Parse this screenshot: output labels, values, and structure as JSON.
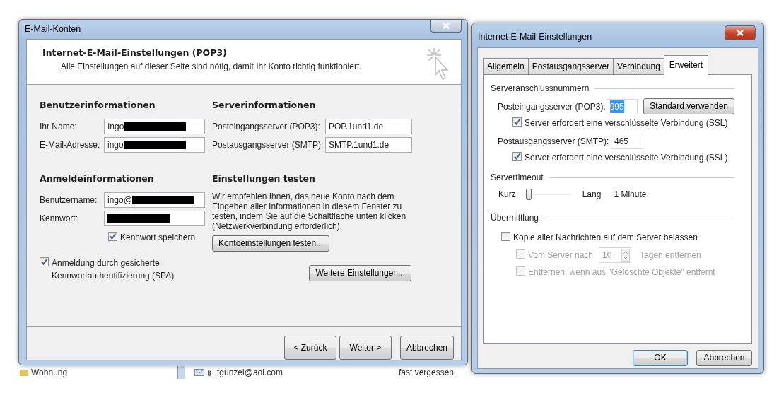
{
  "background_window": {
    "folder": "Wohnung",
    "mail": {
      "sender": "tgunzel@aol.com",
      "subject": "fast vergessen"
    }
  },
  "mail_accounts_dialog": {
    "title": "E-Mail-Konten",
    "header": {
      "title": "Internet-E-Mail-Einstellungen (POP3)",
      "subtitle": "Alle Einstellungen auf dieser Seite sind nötig, damit Ihr Konto richtig funktioniert."
    },
    "user_info": {
      "heading": "Benutzerinformationen",
      "fields": [
        {
          "label": "Ihr Name:",
          "value": "Ingo",
          "redacted": true
        },
        {
          "label": "E-Mail-Adresse:",
          "value": "ingo",
          "redacted": true
        }
      ]
    },
    "logon_info": {
      "heading": "Anmeldeinformationen",
      "fields": [
        {
          "label": "Benutzername:",
          "value": "ingo@",
          "redacted": true
        },
        {
          "label": "Kennwort:",
          "redacted": true
        }
      ],
      "remember_password": {
        "label": "Kennwort speichern",
        "checked": true
      },
      "spa": {
        "label": "Anmeldung durch gesicherte Kennwortauthentifizierung (SPA)",
        "checked": true
      }
    },
    "server_info": {
      "heading": "Serverinformationen",
      "fields": [
        {
          "label": "Posteingangsserver (POP3):",
          "value": "POP.1und1.de"
        },
        {
          "label": "Postausgangsserver (SMTP):",
          "value": "SMTP.1und1.de"
        }
      ]
    },
    "test": {
      "heading": "Einstellungen testen",
      "text": "Wir empfehlen Ihnen, das neue Konto nach dem Eingeben aller Informationen in diesem Fenster zu testen, indem Sie auf die Schaltfläche unten klicken (Netzwerkverbindung erforderlich).",
      "button": "Kontoeinstellungen testen..."
    },
    "more_settings_button": "Weitere Einstellungen...",
    "buttons": [
      "< Zurück",
      "Weiter >",
      "Abbrechen"
    ]
  },
  "internet_settings_dialog": {
    "title": "Internet-E-Mail-Einstellungen",
    "tabs": [
      {
        "label": "Allgemein",
        "selected": false
      },
      {
        "label": "Postausgangsserver",
        "selected": false
      },
      {
        "label": "Verbindung",
        "selected": false
      },
      {
        "label": "Erweitert",
        "selected": true
      }
    ],
    "ports": {
      "heading": "Serveranschlussnummern",
      "incoming": {
        "label": "Posteingangsserver (POP3):",
        "value": "995",
        "value_selected": true,
        "default_button": "Standard verwenden",
        "ssl": {
          "label": "Server erfordert eine verschlüsselte Verbindung (SSL)",
          "checked": true
        }
      },
      "outgoing": {
        "label": "Postausgangsserver (SMTP):",
        "value": "465",
        "value_selected": false,
        "ssl": {
          "label": "Server erfordert eine verschlüsselte Verbindung (SSL)",
          "checked": true
        }
      }
    },
    "timeout": {
      "heading": "Servertimeout",
      "min_label": "Kurz",
      "max_label": "Lang",
      "level": 0.1,
      "reading": "1 Minute"
    },
    "delivery": {
      "heading": "Übermittlung",
      "leave_copy": {
        "label": "Kopie aller Nachrichten auf dem Server belassen",
        "checked": false,
        "disabled": false
      },
      "remove_after": {
        "label": "Vom Server nach",
        "value": "10",
        "suffix": "Tagen entfernen",
        "checked": false,
        "disabled": true
      },
      "remove_deleted": {
        "label": "Entfernen, wenn aus \"Gelöschte Objekte\" entfernt",
        "checked": false,
        "disabled": true
      }
    },
    "buttons": [
      {
        "label": "OK",
        "default": true
      },
      {
        "label": "Abbrechen",
        "default": false
      }
    ]
  }
}
